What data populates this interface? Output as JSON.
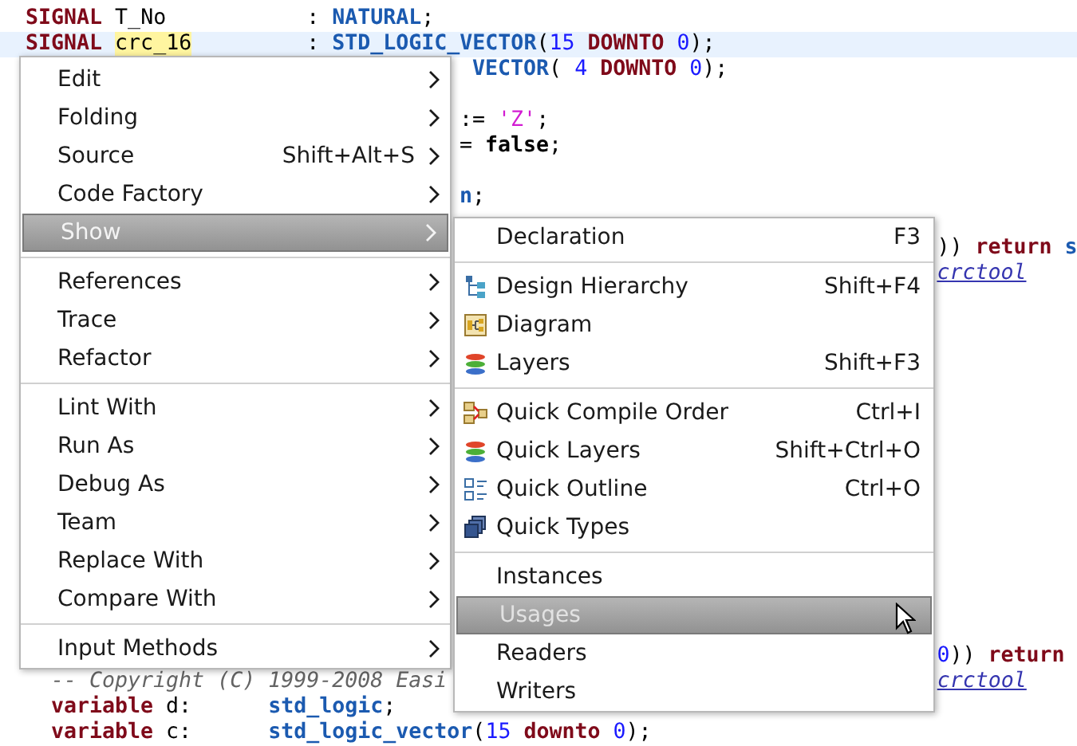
{
  "editor": {
    "lines": [
      {
        "current": false,
        "segments": [
          [
            {
              "kind": "keyword",
              "text": "SIGNAL"
            },
            {
              "kind": "plain",
              "text": " T_No"
            }
          ],
          [
            {
              "kind": "plain",
              "text": ": "
            },
            {
              "kind": "type",
              "text": "NATURAL"
            },
            {
              "kind": "plain",
              "text": ";"
            }
          ]
        ]
      },
      {
        "current": true,
        "segments": [
          [
            {
              "kind": "keyword",
              "text": "SIGNAL "
            },
            {
              "kind": "mark",
              "text": "crc_16"
            }
          ],
          [
            {
              "kind": "plain",
              "text": ": "
            },
            {
              "kind": "type",
              "text": "STD_LOGIC_VECTOR"
            },
            {
              "kind": "plain",
              "text": "("
            },
            {
              "kind": "number",
              "text": "15"
            },
            {
              "kind": "keyword",
              "text": " DOWNTO"
            },
            {
              "kind": "number",
              "text": " 0"
            },
            {
              "kind": "plain",
              "text": ");"
            }
          ]
        ]
      },
      {
        "current": false,
        "segments": [
          [
            {
              "kind": "type",
              "text": "VECTOR"
            },
            {
              "kind": "plain",
              "text": "( "
            },
            {
              "kind": "number",
              "text": "4"
            },
            {
              "kind": "keyword",
              "text": " DOWNTO"
            },
            {
              "kind": "number",
              "text": " 0"
            },
            {
              "kind": "plain",
              "text": ");"
            }
          ]
        ]
      },
      {
        "current": false,
        "segments": [
          [
            {
              "kind": "plain",
              "text": ":= "
            },
            {
              "kind": "string",
              "text": "'Z'"
            },
            {
              "kind": "plain",
              "text": ";"
            }
          ]
        ]
      },
      {
        "current": false,
        "segments": [
          [
            {
              "kind": "plain",
              "text": "= "
            },
            {
              "kind": "bold",
              "text": "false"
            },
            {
              "kind": "plain",
              "text": ";"
            }
          ]
        ]
      },
      {
        "current": false,
        "segments": [
          [
            {
              "kind": "type",
              "text": "n"
            },
            {
              "kind": "plain",
              "text": ";"
            }
          ]
        ]
      },
      {
        "current": false,
        "segments": [
          [
            {
              "kind": "plain",
              "text": "))"
            },
            {
              "kind": "keyword",
              "text": " return"
            },
            {
              "kind": "type",
              "text": " s"
            }
          ]
        ]
      },
      {
        "current": false,
        "segments": [
          [
            {
              "kind": "link",
              "text": "crctool"
            }
          ]
        ]
      },
      {
        "current": false,
        "segments": [
          [
            {
              "kind": "number",
              "text": "0"
            },
            {
              "kind": "plain",
              "text": "))"
            },
            {
              "kind": "keyword",
              "text": " return"
            }
          ]
        ]
      },
      {
        "current": false,
        "segments": [
          [
            {
              "kind": "comment",
              "text": "-- Copyright (C) 1999-2008 Easi"
            }
          ],
          [
            {
              "kind": "link",
              "text": "crctool"
            }
          ]
        ]
      },
      {
        "current": false,
        "segments": [
          [
            {
              "kind": "keyword",
              "text": "variable"
            },
            {
              "kind": "plain",
              "text": " d:"
            }
          ],
          [
            {
              "kind": "type",
              "text": "std_logic"
            },
            {
              "kind": "plain",
              "text": ";"
            }
          ]
        ]
      },
      {
        "current": false,
        "segments": [
          [
            {
              "kind": "keyword",
              "text": "variable"
            },
            {
              "kind": "plain",
              "text": " c:"
            }
          ],
          [
            {
              "kind": "type",
              "text": "std_logic_vector"
            },
            {
              "kind": "plain",
              "text": "("
            },
            {
              "kind": "number",
              "text": "15"
            },
            {
              "kind": "keyword",
              "text": " downto"
            },
            {
              "kind": "number",
              "text": " 0"
            },
            {
              "kind": "plain",
              "text": ");"
            }
          ]
        ]
      }
    ]
  },
  "context_menu": {
    "groups": [
      [
        {
          "label": "Edit",
          "submenu": true,
          "selected": false
        },
        {
          "label": "Folding",
          "submenu": true,
          "selected": false
        },
        {
          "label": "Source",
          "shortcut": "Shift+Alt+S",
          "submenu": true,
          "selected": false
        },
        {
          "label": "Code Factory",
          "submenu": true,
          "selected": false
        },
        {
          "label": "Show",
          "submenu": true,
          "selected": true
        }
      ],
      [
        {
          "label": "References",
          "submenu": true,
          "selected": false
        },
        {
          "label": "Trace",
          "submenu": true,
          "selected": false
        },
        {
          "label": "Refactor",
          "submenu": true,
          "selected": false
        }
      ],
      [
        {
          "label": "Lint With",
          "submenu": true,
          "selected": false
        },
        {
          "label": "Run As",
          "submenu": true,
          "selected": false
        },
        {
          "label": "Debug As",
          "submenu": true,
          "selected": false
        },
        {
          "label": "Team",
          "submenu": true,
          "selected": false
        },
        {
          "label": "Replace With",
          "submenu": true,
          "selected": false
        },
        {
          "label": "Compare With",
          "submenu": true,
          "selected": false
        }
      ],
      [
        {
          "label": "Input Methods",
          "submenu": true,
          "selected": false
        }
      ]
    ]
  },
  "show_submenu": {
    "groups": [
      [
        {
          "kind": "plain",
          "label": "Declaration",
          "shortcut": "F3",
          "selected": false
        }
      ],
      [
        {
          "kind": "hierarchy",
          "label": "Design Hierarchy",
          "shortcut": "Shift+F4",
          "selected": false
        },
        {
          "kind": "diagram",
          "label": "Diagram",
          "selected": false
        },
        {
          "kind": "layers",
          "label": "Layers",
          "shortcut": "Shift+F3",
          "selected": false
        }
      ],
      [
        {
          "kind": "compile-order",
          "label": "Quick Compile Order",
          "shortcut": "Ctrl+I",
          "selected": false
        },
        {
          "kind": "layers",
          "label": "Quick Layers",
          "shortcut": "Shift+Ctrl+O",
          "selected": false
        },
        {
          "kind": "outline",
          "label": "Quick Outline",
          "shortcut": "Ctrl+O",
          "selected": false
        },
        {
          "kind": "types",
          "label": "Quick Types",
          "selected": false
        }
      ],
      [
        {
          "kind": "plain",
          "label": "Instances",
          "selected": false
        },
        {
          "kind": "plain",
          "label": "Usages",
          "selected": true
        },
        {
          "kind": "plain",
          "label": "Readers",
          "selected": false
        },
        {
          "kind": "plain",
          "label": "Writers",
          "selected": false
        }
      ]
    ]
  }
}
